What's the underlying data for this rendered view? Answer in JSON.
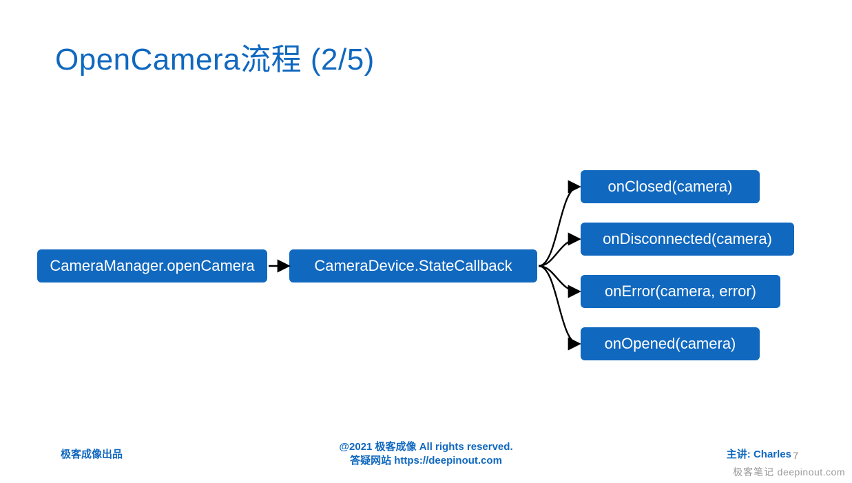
{
  "title": "OpenCamera流程 (2/5)",
  "nodes": {
    "root": {
      "label": "CameraManager.openCamera"
    },
    "callback": {
      "label": "CameraDevice.StateCallback"
    },
    "cb0": {
      "label": "onClosed(camera)"
    },
    "cb1": {
      "label": "onDisconnected(camera)"
    },
    "cb2": {
      "label": "onError(camera, error)"
    },
    "cb3": {
      "label": "onOpened(camera)"
    }
  },
  "footer": {
    "left": "极客成像出品",
    "center_line1": "@2021 极客成像 All rights reserved.",
    "center_line2": "答疑网站 https://deepinout.com",
    "right": "主讲: Charles",
    "page": "7"
  },
  "watermark": {
    "brand": "极客笔记",
    "url": "deepinout.com"
  },
  "colors": {
    "primary": "#1068bf"
  }
}
